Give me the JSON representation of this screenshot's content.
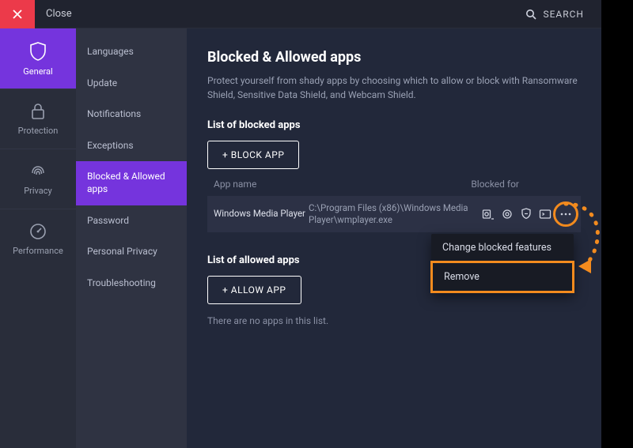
{
  "titlebar": {
    "close_label": "Close",
    "search_label": "SEARCH"
  },
  "nav": {
    "items": [
      {
        "label": "General"
      },
      {
        "label": "Protection"
      },
      {
        "label": "Privacy"
      },
      {
        "label": "Performance"
      }
    ]
  },
  "subnav": {
    "items": [
      {
        "label": "Languages"
      },
      {
        "label": "Update"
      },
      {
        "label": "Notifications"
      },
      {
        "label": "Exceptions"
      },
      {
        "label": "Blocked & Allowed apps"
      },
      {
        "label": "Password"
      },
      {
        "label": "Personal Privacy"
      },
      {
        "label": "Troubleshooting"
      }
    ]
  },
  "main": {
    "title": "Blocked & Allowed apps",
    "description": "Protect yourself from shady apps by choosing which to allow or block with Ransomware Shield, Sensitive Data Shield, and Webcam Shield.",
    "blocked": {
      "heading": "List of blocked apps",
      "button": "+ BLOCK APP",
      "col_name": "App name",
      "col_blocked": "Blocked for",
      "rows": [
        {
          "name": "Windows Media Player",
          "path": "C:\\Program Files (x86)\\Windows Media Player\\wmplayer.exe"
        }
      ]
    },
    "allowed": {
      "heading": "List of allowed apps",
      "button": "+ ALLOW APP",
      "empty_text": "There are no apps in this list."
    }
  },
  "context_menu": {
    "items": [
      {
        "label": "Change blocked features"
      },
      {
        "label": "Remove"
      }
    ]
  },
  "icons": {
    "close": "close-icon",
    "search": "search-icon",
    "shield": "shield-icon",
    "lock": "lock-icon",
    "fingerprint": "fingerprint-icon",
    "gauge": "gauge-icon",
    "webcam": "webcam-icon",
    "camera": "camera-icon",
    "shield_small": "shield-small-icon",
    "terminal": "terminal-icon",
    "more": "more-icon"
  },
  "colors": {
    "accent": "#7534dd",
    "danger": "#ec3a4a",
    "highlight": "#f38b1e",
    "bg_main": "#22283a",
    "bg_nav": "#292d3a",
    "bg_subnav": "#2f3342"
  }
}
